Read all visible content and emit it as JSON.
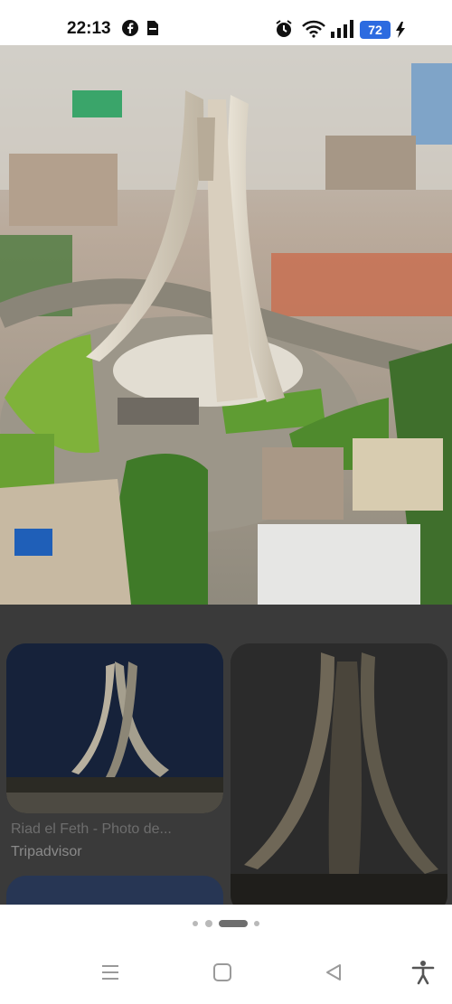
{
  "status_bar": {
    "time": "22:13",
    "battery_level": "72",
    "icons": [
      "facebook-icon",
      "notification-app-icon",
      "alarm-icon",
      "wifi-icon",
      "signal-icon",
      "battery-icon",
      "charging-icon"
    ],
    "battery_color": "#2c6be0"
  },
  "hero": {
    "icon": "photo-of-monument"
  },
  "results": {
    "items": [
      {
        "title": "Riad el Feth - Photo de...",
        "source": "Tripadvisor"
      }
    ]
  },
  "pager": {
    "dot_count": 4,
    "active_index": 2
  },
  "nav": {
    "icons": [
      "recent-apps-icon",
      "home-icon",
      "back-icon",
      "accessibility-icon"
    ]
  }
}
